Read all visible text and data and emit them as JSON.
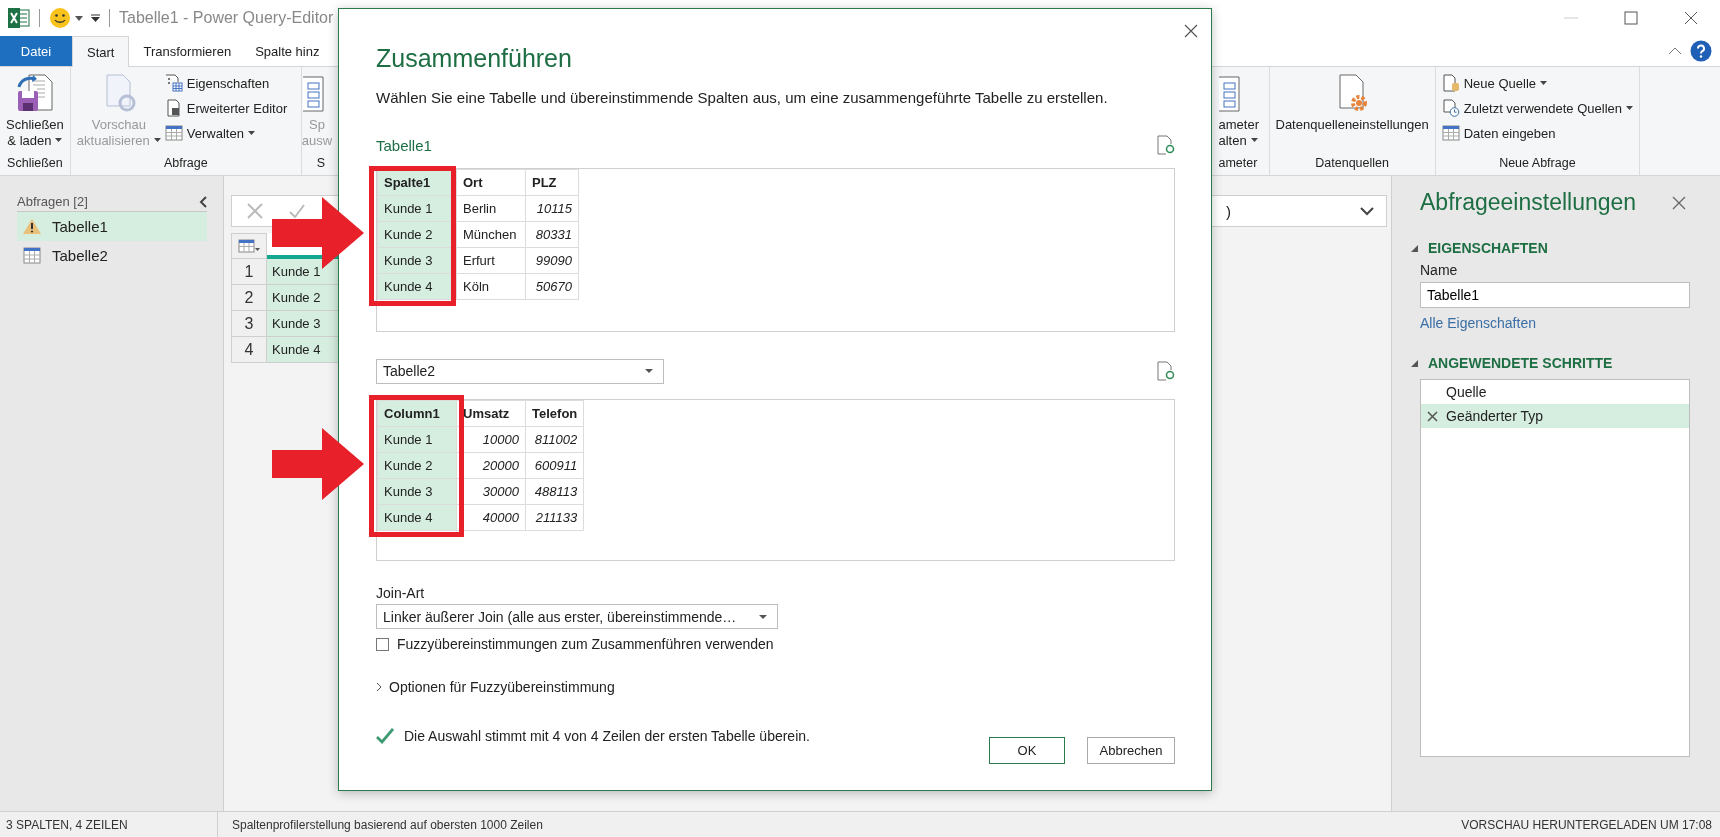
{
  "window": {
    "title": "Tabelle1 - Power Query-Editor"
  },
  "ribbon_tabs": [
    {
      "label": "Datei",
      "kind": "file",
      "selected": false
    },
    {
      "label": "Start",
      "kind": "tab",
      "selected": true
    },
    {
      "label": "Transformieren",
      "kind": "tab",
      "selected": false
    },
    {
      "label": "Spalte hinz",
      "kind": "tab",
      "selected": false
    }
  ],
  "ribbon_left": [
    {
      "kind": "close",
      "label": "Schließen",
      "button": {
        "lines": [
          "Schließen",
          "& laden"
        ],
        "menu": true,
        "disabled": false
      }
    },
    {
      "kind": "query",
      "label": "Abfrage",
      "button": {
        "lines": [
          "Vorschau",
          "aktualisieren"
        ],
        "menu": true,
        "disabled": true
      },
      "items": [
        {
          "label": "Eigenschaften",
          "menu": false
        },
        {
          "label": "Erweiterter Editor",
          "menu": false
        },
        {
          "label": "Verwalten",
          "menu": true
        }
      ]
    },
    {
      "kind": "partial",
      "label": "S",
      "button": {
        "lines": [
          "Sp",
          "ausw"
        ],
        "menu": false,
        "disabled": true
      }
    }
  ],
  "ribbon_right": [
    {
      "kind": "partial",
      "label": "ameter",
      "button": {
        "lines": [
          "ameter",
          "alten"
        ],
        "menu": true,
        "disabled": false
      }
    },
    {
      "kind": "datasources",
      "label": "Datenquellen",
      "button": {
        "lines": [
          "Datenquelleneinstellungen"
        ],
        "menu": false,
        "disabled": false
      }
    },
    {
      "kind": "newquery",
      "label": "Neue Abfrage",
      "items": [
        {
          "label": "Neue Quelle",
          "menu": true
        },
        {
          "label": "Zuletzt verwendete Quellen",
          "menu": true
        },
        {
          "label": "Daten eingeben",
          "menu": false
        }
      ]
    }
  ],
  "queries": {
    "title": "Abfragen [2]",
    "items": [
      {
        "name": "Tabelle1",
        "selected": true,
        "warning": true
      },
      {
        "name": "Tabelle2",
        "selected": false,
        "warning": false
      }
    ]
  },
  "formula_bar": {
    "text_end": ")"
  },
  "grid": {
    "rows": [
      {
        "number": "1",
        "value": "Kunde 1"
      },
      {
        "number": "2",
        "value": "Kunde 2"
      },
      {
        "number": "3",
        "value": "Kunde 3"
      },
      {
        "number": "4",
        "value": "Kunde 4"
      }
    ]
  },
  "dialog": {
    "title": "Zusammenführen",
    "description": "Wählen Sie eine Tabelle und übereinstimmende Spalten aus, um eine zusammengeführte Tabelle zu erstellen.",
    "first": {
      "name": "Tabelle1",
      "columns": [
        {
          "label": "Spalte1",
          "kind": "text",
          "selected": true
        },
        {
          "label": "Ort",
          "kind": "text",
          "selected": false
        },
        {
          "label": "PLZ",
          "kind": "number",
          "selected": false
        }
      ],
      "rows": [
        [
          "Kunde 1",
          "Berlin",
          "10115"
        ],
        [
          "Kunde 2",
          "München",
          "80331"
        ],
        [
          "Kunde 3",
          "Erfurt",
          "99090"
        ],
        [
          "Kunde 4",
          "Köln",
          "50670"
        ]
      ]
    },
    "second": {
      "source": "Tabelle2",
      "columns": [
        {
          "label": "Column1",
          "kind": "text",
          "selected": true
        },
        {
          "label": "Umsatz",
          "kind": "number",
          "selected": false
        },
        {
          "label": "Telefon",
          "kind": "number",
          "selected": false
        }
      ],
      "rows": [
        [
          "Kunde 1",
          "10000",
          "811002"
        ],
        [
          "Kunde 2",
          "20000",
          "600911"
        ],
        [
          "Kunde 3",
          "30000",
          "488113"
        ],
        [
          "Kunde 4",
          "40000",
          "211133"
        ]
      ]
    },
    "join": {
      "label": "Join-Art",
      "value": "Linker äußerer Join (alle aus erster, übereinstimmende…"
    },
    "fuzzy": {
      "label": "Fuzzyübereinstimmungen zum Zusammenführen verwenden",
      "checked": false
    },
    "options": {
      "label": "Optionen für Fuzzyübereinstimmung",
      "expanded": false
    },
    "result": {
      "text": "Die Auswahl stimmt mit 4 von 4 Zeilen der ersten Tabelle überein.",
      "ok": true
    },
    "buttons": [
      {
        "label": "OK",
        "kind": "primary"
      },
      {
        "label": "Abbrechen",
        "kind": "secondary"
      }
    ]
  },
  "settings": {
    "title": "Abfrageeinstellungen",
    "properties_heading": "EIGENSCHAFTEN",
    "name_label": "Name",
    "name_value": "Tabelle1",
    "all_properties": "Alle Eigenschaften",
    "steps_heading": "ANGEWENDETE SCHRITTE",
    "steps": [
      {
        "label": "Quelle",
        "selected": false,
        "deletable": false
      },
      {
        "label": "Geänderter Typ",
        "selected": true,
        "deletable": true
      }
    ]
  },
  "status_bar": {
    "left": [
      "3 SPALTEN, 4 ZEILEN",
      "Spaltenprofilerstellung basierend auf obersten 1000 Zeilen"
    ],
    "right": "VORSCHAU HERUNTERGELADEN UM 17:08"
  }
}
